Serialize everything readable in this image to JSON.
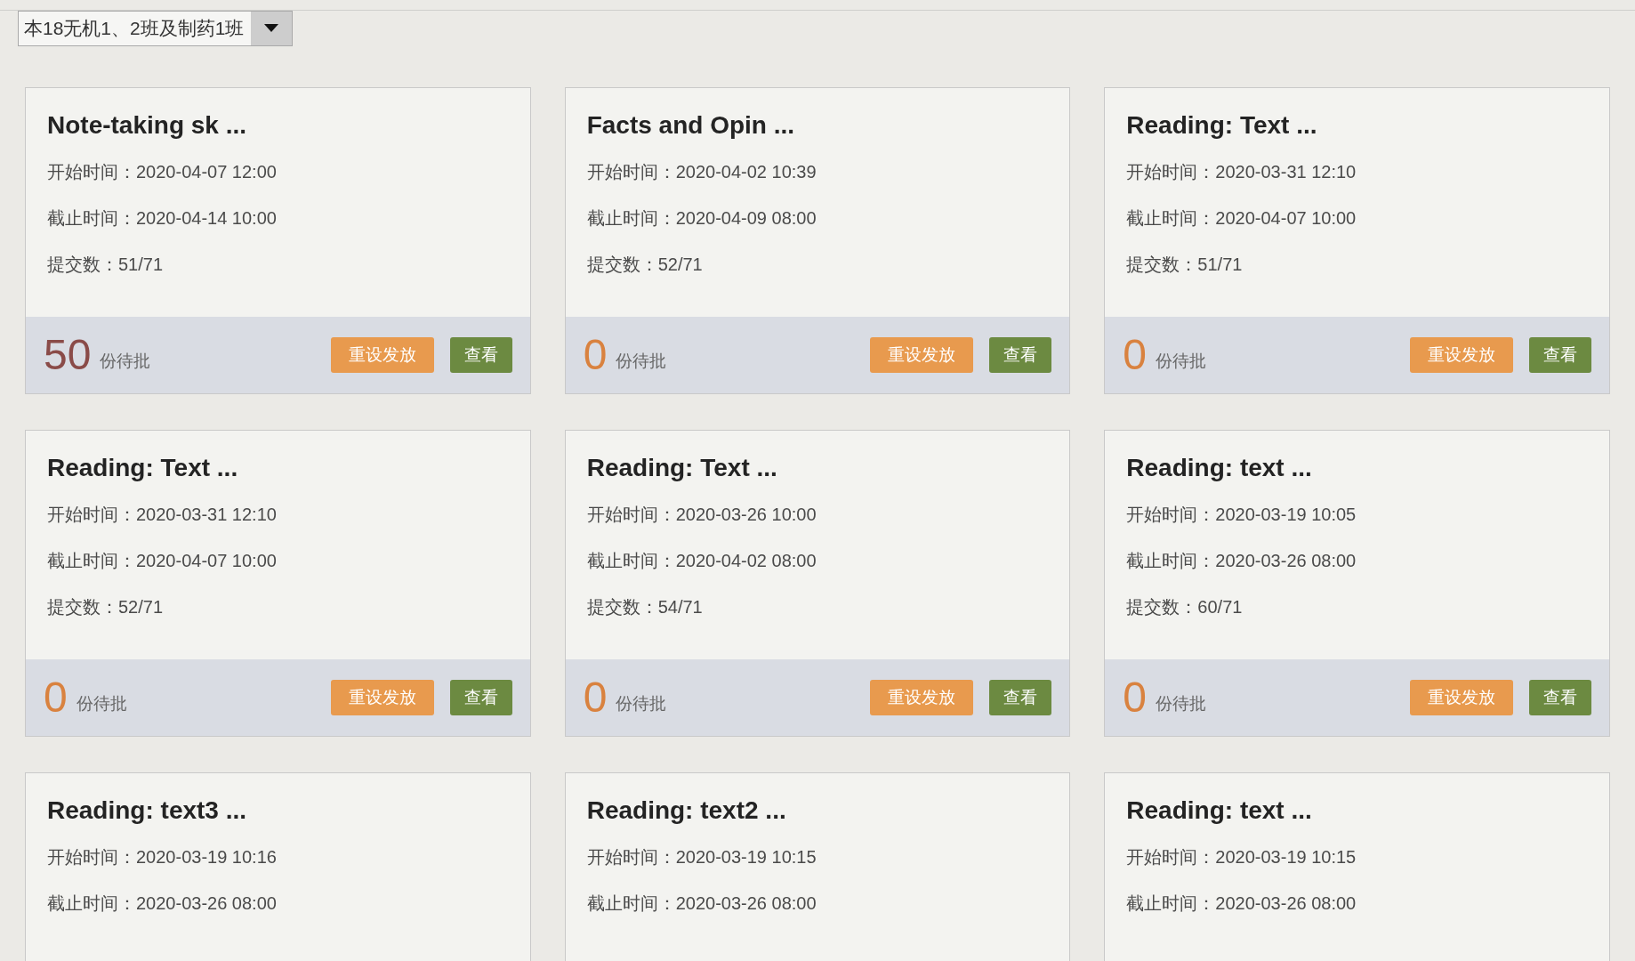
{
  "class_select": {
    "value": "本18无机1、2班及制药1班"
  },
  "assignments": [
    {
      "title": "Note-taking sk ...",
      "start": "开始时间：2020-04-07 12:00",
      "deadline": "截止时间：2020-04-14 10:00",
      "submissions": "提交数：51/71",
      "pending": {
        "count": "50",
        "label": "份待批",
        "color": "#8a4b48"
      },
      "buttons": [
        {
          "kind": "reset",
          "label": "重设发放"
        },
        {
          "kind": "view",
          "label": "查看"
        }
      ]
    },
    {
      "title": "Facts and Opin ...",
      "start": "开始时间：2020-04-02 10:39",
      "deadline": "截止时间：2020-04-09 08:00",
      "submissions": "提交数：52/71",
      "pending": {
        "count": "0",
        "label": "份待批",
        "color": "#d9823f"
      },
      "buttons": [
        {
          "kind": "reset",
          "label": "重设发放"
        },
        {
          "kind": "view",
          "label": "查看"
        }
      ]
    },
    {
      "title": "Reading: Text ...",
      "start": "开始时间：2020-03-31 12:10",
      "deadline": "截止时间：2020-04-07 10:00",
      "submissions": "提交数：51/71",
      "pending": {
        "count": "0",
        "label": "份待批",
        "color": "#d9823f"
      },
      "buttons": [
        {
          "kind": "reset",
          "label": "重设发放"
        },
        {
          "kind": "view",
          "label": "查看"
        }
      ]
    },
    {
      "title": "Reading: Text ...",
      "start": "开始时间：2020-03-31 12:10",
      "deadline": "截止时间：2020-04-07 10:00",
      "submissions": "提交数：52/71",
      "pending": {
        "count": "0",
        "label": "份待批",
        "color": "#d9823f"
      },
      "buttons": [
        {
          "kind": "reset",
          "label": "重设发放"
        },
        {
          "kind": "view",
          "label": "查看"
        }
      ]
    },
    {
      "title": "Reading: Text ...",
      "start": "开始时间：2020-03-26 10:00",
      "deadline": "截止时间：2020-04-02 08:00",
      "submissions": "提交数：54/71",
      "pending": {
        "count": "0",
        "label": "份待批",
        "color": "#d9823f"
      },
      "buttons": [
        {
          "kind": "reset",
          "label": "重设发放"
        },
        {
          "kind": "view",
          "label": "查看"
        }
      ]
    },
    {
      "title": "Reading: text ...",
      "start": "开始时间：2020-03-19 10:05",
      "deadline": "截止时间：2020-03-26 08:00",
      "submissions": "提交数：60/71",
      "pending": {
        "count": "0",
        "label": "份待批",
        "color": "#d9823f"
      },
      "buttons": [
        {
          "kind": "reset",
          "label": "重设发放"
        },
        {
          "kind": "view",
          "label": "查看"
        }
      ]
    },
    {
      "title": "Reading: text3 ...",
      "start": "开始时间：2020-03-19 10:16",
      "deadline": "截止时间：2020-03-26 08:00"
    },
    {
      "title": "Reading: text2 ...",
      "start": "开始时间：2020-03-19 10:15",
      "deadline": "截止时间：2020-03-26 08:00"
    },
    {
      "title": "Reading: text ...",
      "start": "开始时间：2020-03-19 10:15",
      "deadline": "截止时间：2020-03-26 08:00"
    }
  ]
}
